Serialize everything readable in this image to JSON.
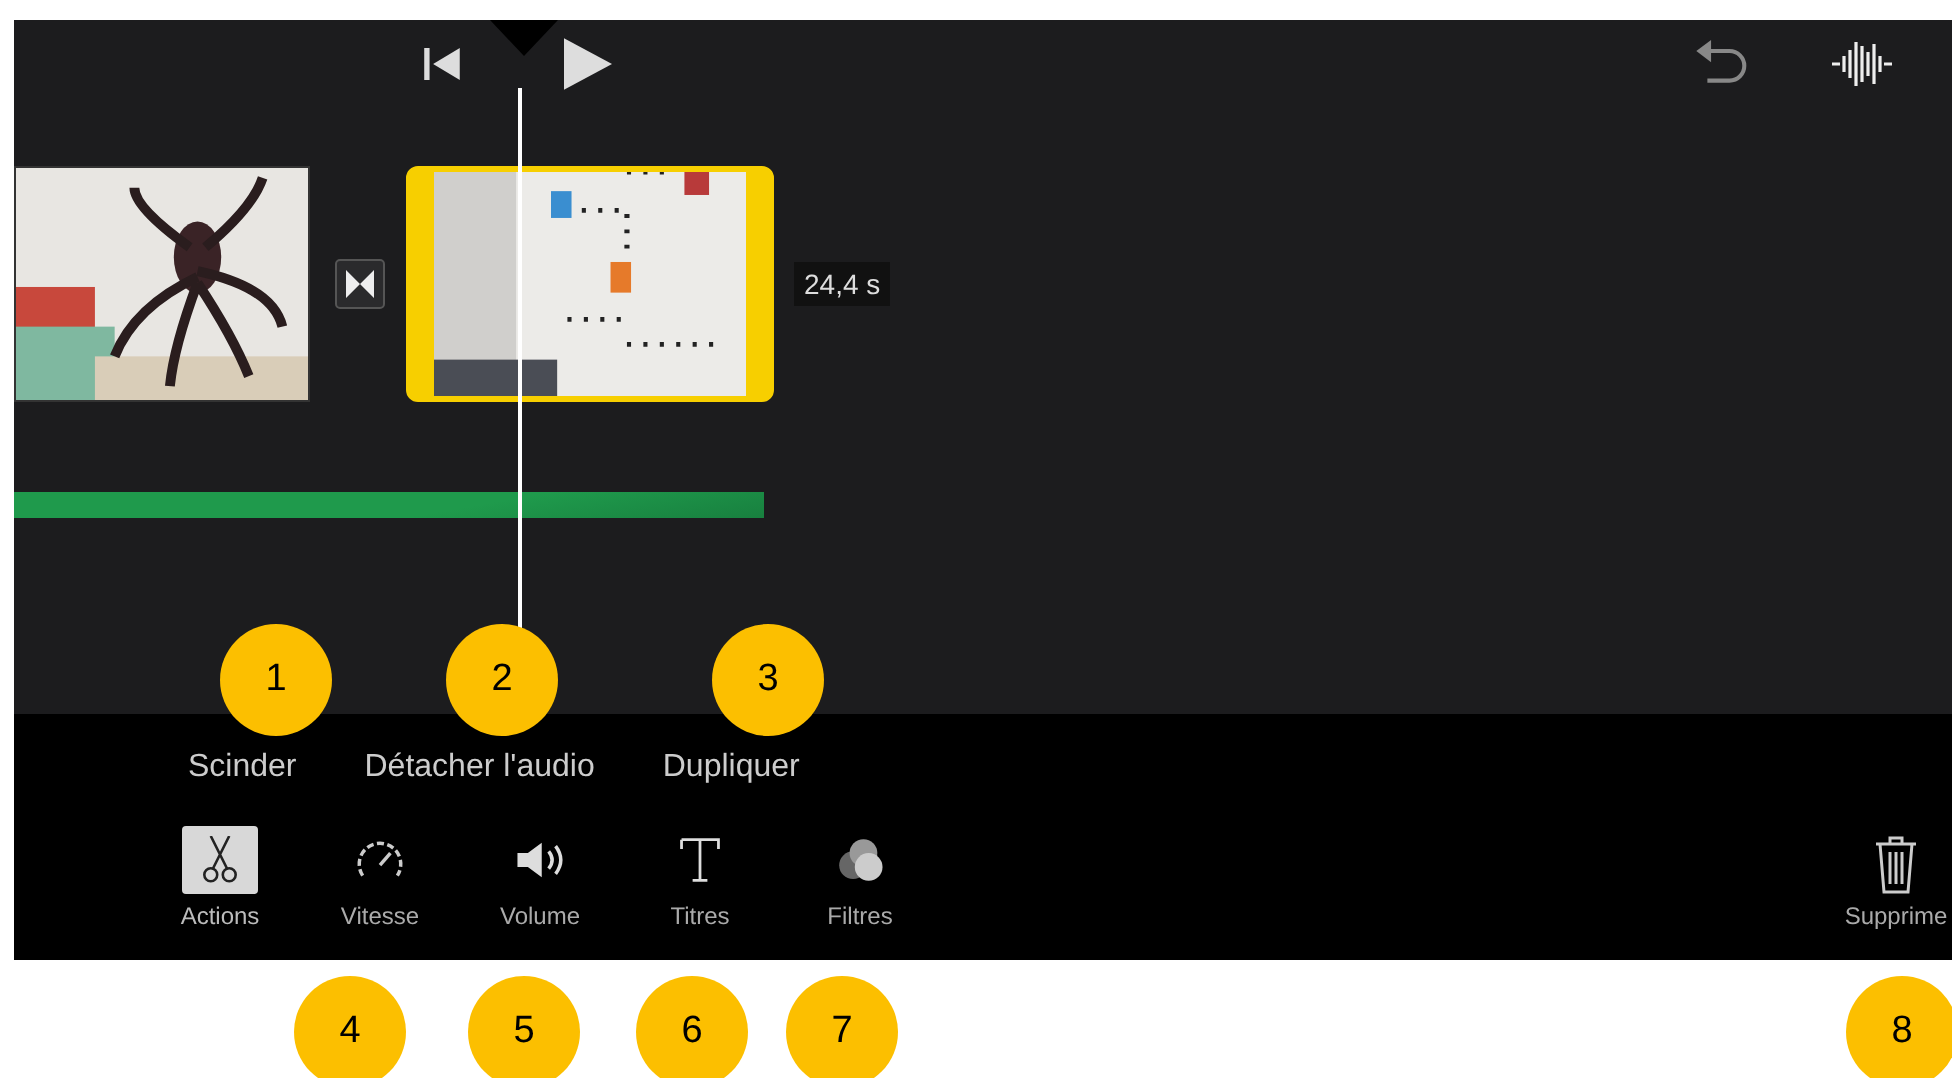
{
  "timeline": {
    "clips": [
      {
        "kind": "picture",
        "selected": false
      },
      {
        "kind": "picture",
        "selected": true
      }
    ],
    "duration": "24,4 s"
  },
  "actions": [
    "Scinder",
    "Détacher l'audio",
    "Dupliquer"
  ],
  "tools": [
    {
      "label": "Actions",
      "selected": true
    },
    {
      "label": "Vitesse",
      "selected": false
    },
    {
      "label": "Volume",
      "selected": false
    },
    {
      "label": "Titres",
      "selected": false
    },
    {
      "label": "Filtres",
      "selected": false
    }
  ],
  "delete_label": "Supprime",
  "callouts": [
    "1",
    "2",
    "3",
    "4",
    "5",
    "6",
    "7",
    "8"
  ]
}
